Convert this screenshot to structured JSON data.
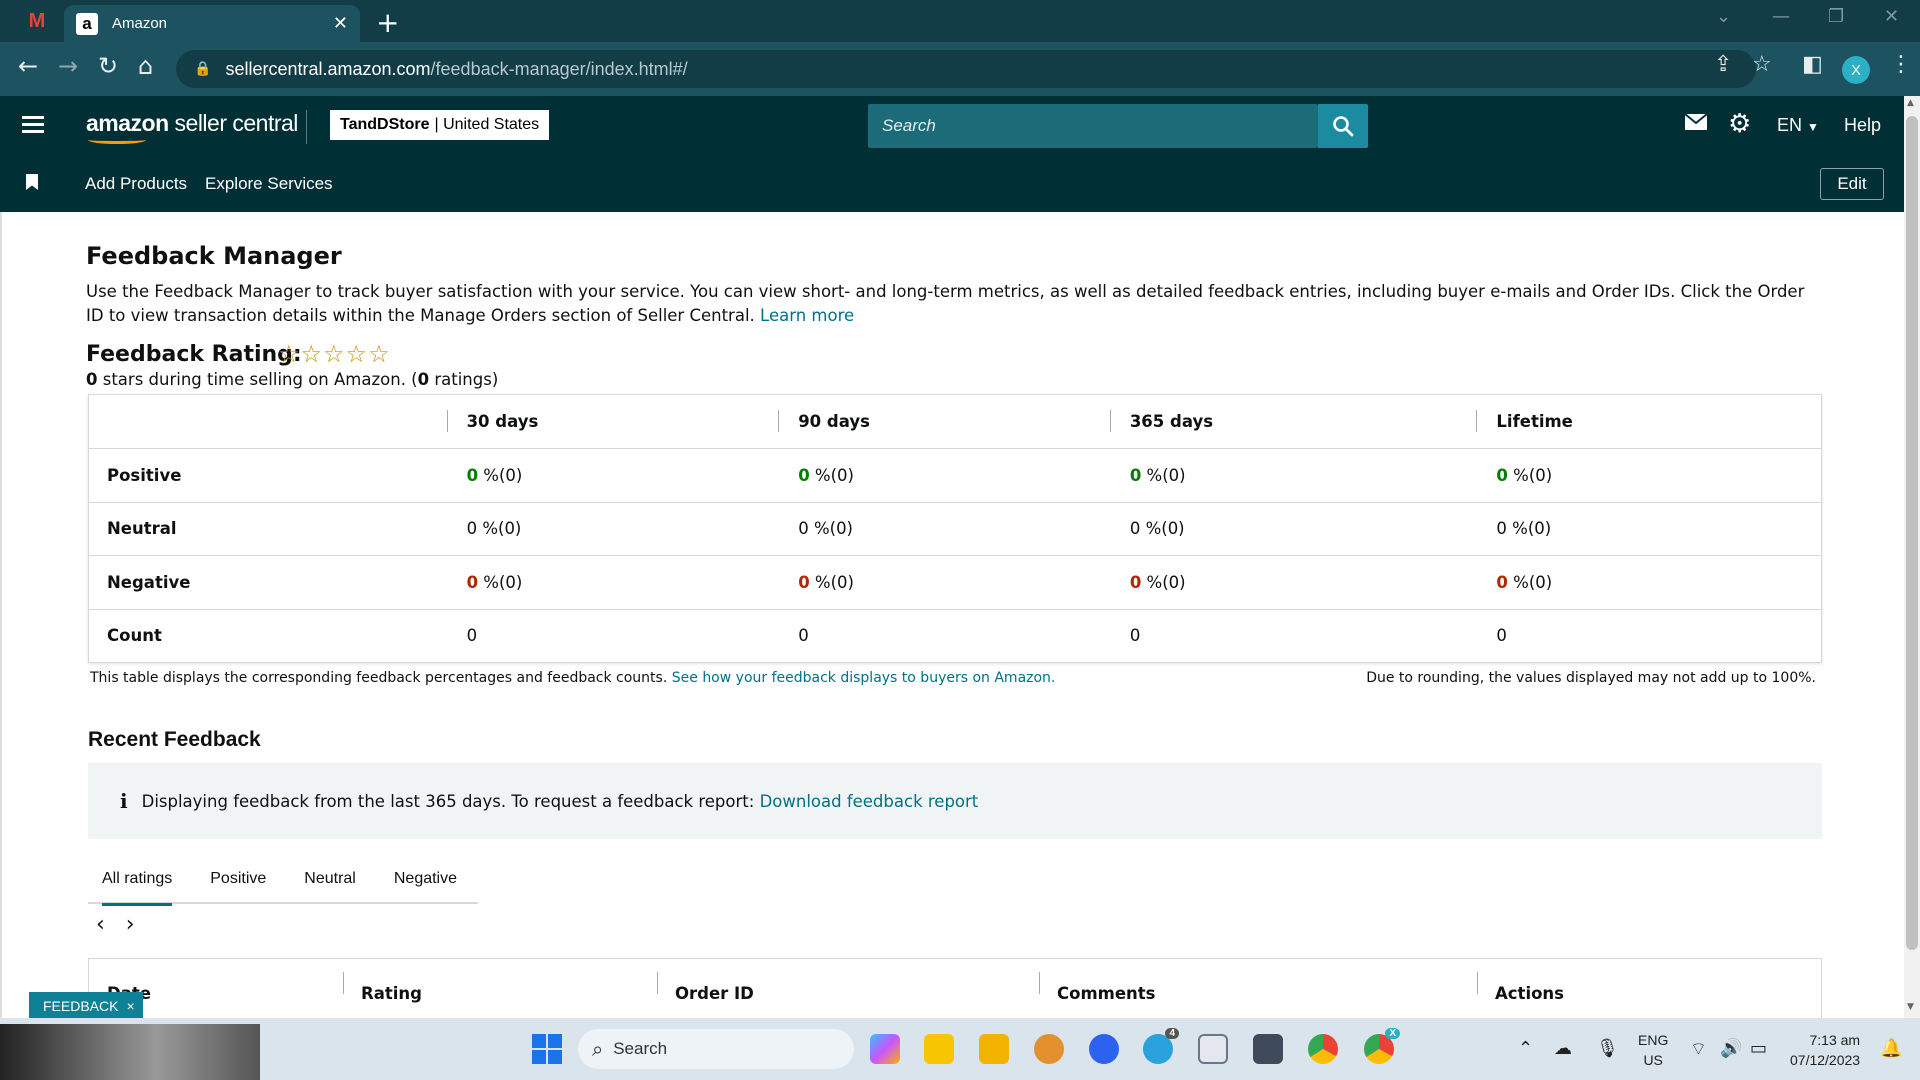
{
  "browser": {
    "tab_title": "Amazon",
    "tab_favicon": "a",
    "gmail_icon": "M",
    "new_tab": "+",
    "url_host": "sellercentral.amazon.com",
    "url_path": "/feedback-manager/index.html#/",
    "profile_initial": "X"
  },
  "header": {
    "logo_bold": "amazon",
    "logo_light": " seller central",
    "store_name": "TandDStore",
    "store_region": "| United States",
    "search_placeholder": "Search",
    "language": "EN",
    "help": "Help"
  },
  "nav": {
    "add_products": "Add Products",
    "explore_services": "Explore Services",
    "edit": "Edit"
  },
  "page": {
    "title": "Feedback Manager",
    "intro": "Use the Feedback Manager to track buyer satisfaction with your service. You can view short- and long-term metrics, as well as detailed feedback entries, including buyer e-mails and Order IDs. Click the Order ID to view transaction details within the Manage Orders section of Seller Central.",
    "learn_more": "Learn more",
    "rating_title": "Feedback Rating:",
    "stars": "☆☆☆☆☆",
    "stars_count": "0",
    "stars_text": " stars during time selling on Amazon. (",
    "ratings_count": "0",
    "ratings_text": " ratings)"
  },
  "feedback_table": {
    "columns": [
      "30 days",
      "90 days",
      "365 days",
      "Lifetime"
    ],
    "rows": [
      {
        "label": "Positive",
        "type": "pos",
        "cells": [
          {
            "v": "0",
            "r": " %(0)"
          },
          {
            "v": "0",
            "r": " %(0)"
          },
          {
            "v": "0",
            "r": " %(0)"
          },
          {
            "v": "0",
            "r": " %(0)"
          }
        ]
      },
      {
        "label": "Neutral",
        "type": "neu",
        "cells": [
          {
            "v": "0",
            "r": " %(0)"
          },
          {
            "v": "0",
            "r": " %(0)"
          },
          {
            "v": "0",
            "r": " %(0)"
          },
          {
            "v": "0",
            "r": " %(0)"
          }
        ]
      },
      {
        "label": "Negative",
        "type": "neg",
        "cells": [
          {
            "v": "0",
            "r": " %(0)"
          },
          {
            "v": "0",
            "r": " %(0)"
          },
          {
            "v": "0",
            "r": " %(0)"
          },
          {
            "v": "0",
            "r": " %(0)"
          }
        ]
      },
      {
        "label": "Count",
        "type": "cnt",
        "cells": [
          {
            "v": "0",
            "r": ""
          },
          {
            "v": "0",
            "r": ""
          },
          {
            "v": "0",
            "r": ""
          },
          {
            "v": "0",
            "r": ""
          }
        ]
      }
    ],
    "note": "This table displays the corresponding feedback percentages and feedback counts.",
    "note_link": "See how your feedback displays to buyers on Amazon.",
    "note_right": "Due to rounding, the values displayed may not add up to 100%."
  },
  "recent": {
    "title": "Recent Feedback",
    "info_icon": "i",
    "info_text": "Displaying feedback from the last 365 days. To request a feedback report:",
    "info_link": "Download feedback report",
    "tabs": [
      "All ratings",
      "Positive",
      "Neutral",
      "Negative"
    ],
    "pager_prev": "‹",
    "pager_next": "›",
    "columns": [
      "Date",
      "Rating",
      "Order ID",
      "Comments",
      "Actions"
    ]
  },
  "feedback_pill": {
    "label": "FEEDBACK",
    "close": "×"
  },
  "taskbar": {
    "search": "Search",
    "language_top": "ENG",
    "language_bottom": "US",
    "time": "7:13 am",
    "date": "07/12/2023",
    "telegram_badge": "4",
    "chrome_badge": "X"
  },
  "colors": {
    "brand_dark": "#002f36",
    "accent_teal": "#007185",
    "positive": "#067d00",
    "negative": "#b12704"
  }
}
